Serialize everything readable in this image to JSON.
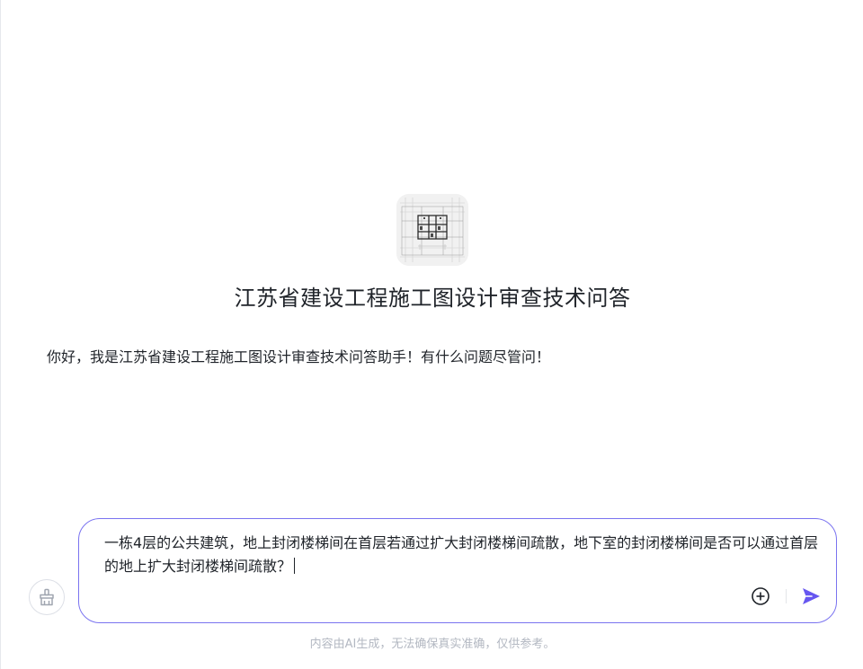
{
  "app": {
    "title": "江苏省建设工程施工图设计审查技术问答",
    "logo_icon": "floor-plan-logo-icon"
  },
  "chat": {
    "greeting": "你好，我是江苏省建设工程施工图设计审查技术问答助手！有什么问题尽管问！"
  },
  "composer": {
    "input_value": "一栋4层的公共建筑，地上封闭楼梯间在首层若通过扩大封闭楼梯间疏散，地下室的封闭楼梯间是否可以通过首层的地上扩大封闭楼梯间疏散？",
    "attach_icon": "plus-circle-icon",
    "send_icon": "send-icon",
    "clear_icon": "broom-icon"
  },
  "footer": {
    "disclaimer": "内容由AI生成，无法确保真实准确，仅供参考。"
  },
  "colors": {
    "accent": "#6656f0",
    "composer_border": "#7a73f0",
    "muted_text": "#b3b8c2"
  }
}
